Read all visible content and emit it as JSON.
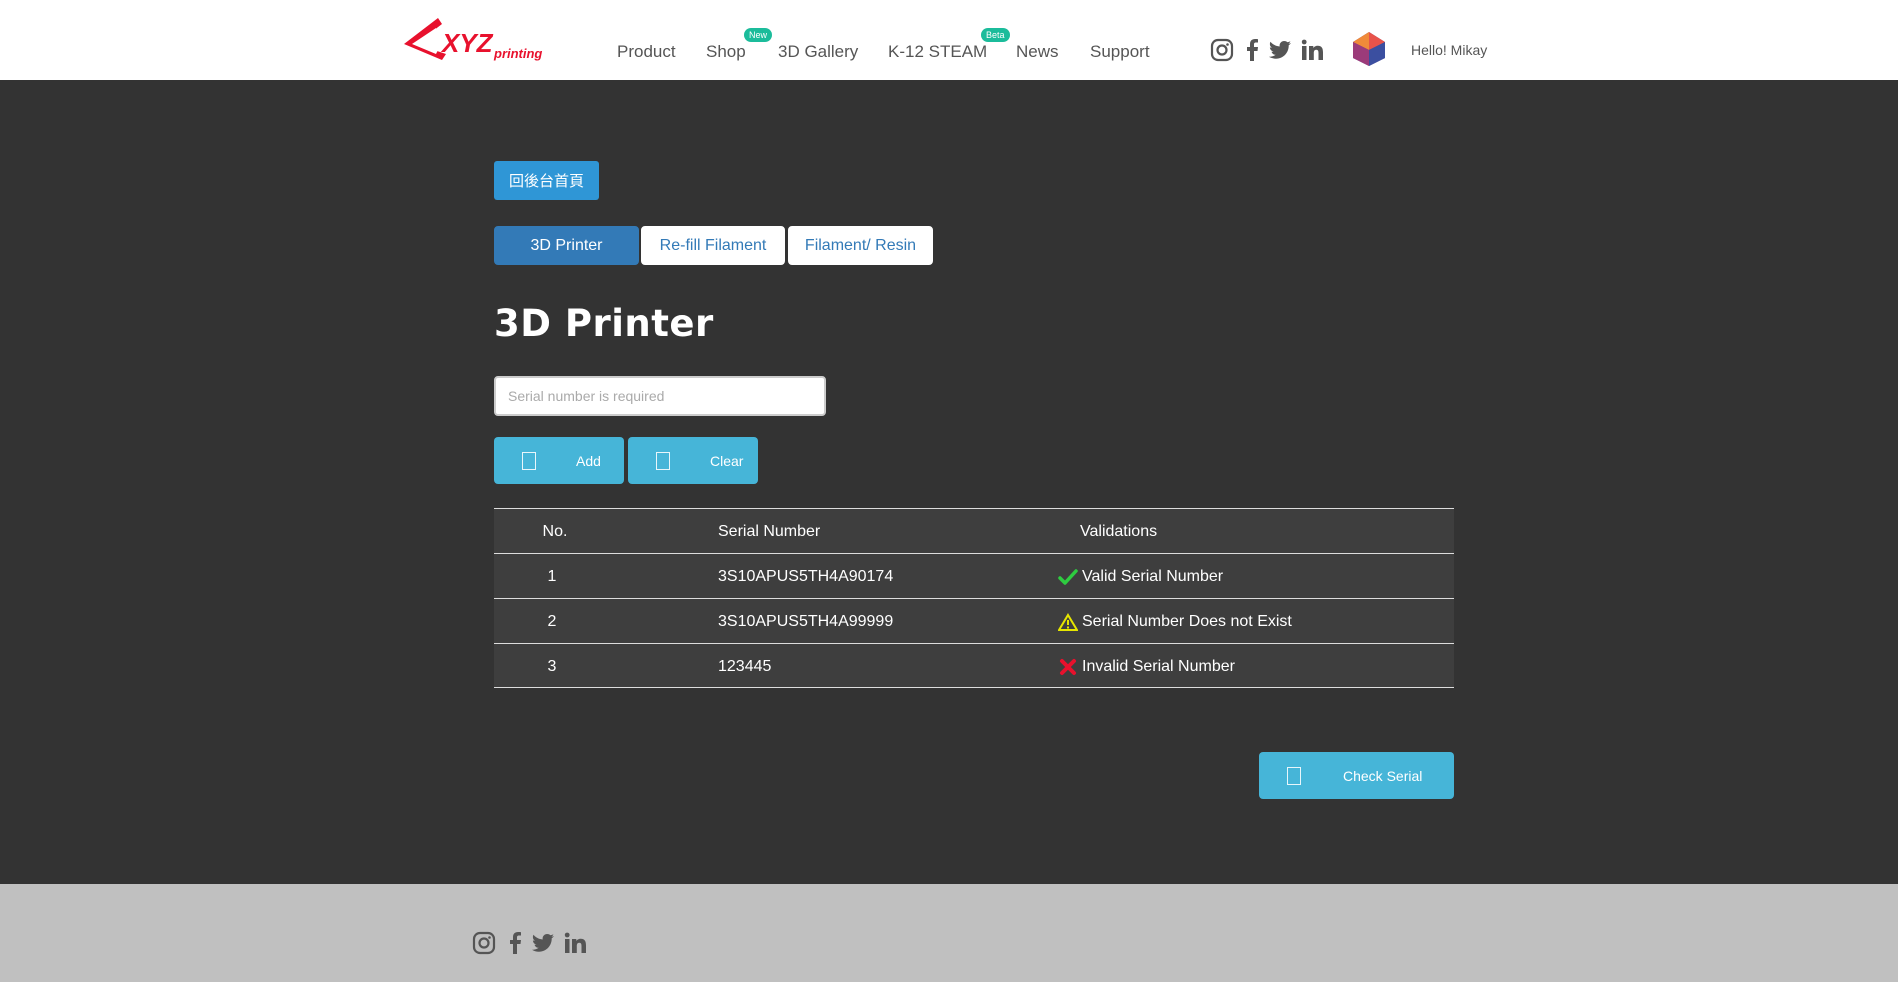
{
  "header": {
    "nav": [
      {
        "label": "Product"
      },
      {
        "label": "Shop",
        "badge": "New"
      },
      {
        "label": "3D Gallery"
      },
      {
        "label": "K-12 STEAM",
        "badge": "Beta"
      },
      {
        "label": "News"
      },
      {
        "label": "Support"
      }
    ],
    "social_icons": [
      "instagram-icon",
      "facebook-icon",
      "twitter-icon",
      "linkedin-icon"
    ],
    "greeting": "Hello! Mikay"
  },
  "main": {
    "back_button": "回後台首頁",
    "tabs": [
      {
        "label": "3D Printer",
        "active": true
      },
      {
        "label": "Re-fill Filament",
        "active": false
      },
      {
        "label": "Filament/ Resin",
        "active": false
      }
    ],
    "title": "3D Printer",
    "serial_input": {
      "placeholder": "Serial number is required",
      "value": ""
    },
    "add_button": "Add",
    "clear_button": "Clear",
    "table": {
      "headers": [
        "No.",
        "Serial Number",
        "Validations"
      ],
      "rows": [
        {
          "no": "1",
          "serial": "3S10APUS5TH4A90174",
          "validation": "Valid Serial Number",
          "status": "valid"
        },
        {
          "no": "2",
          "serial": "3S10APUS5TH4A99999",
          "validation": "Serial Number Does not Exist",
          "status": "warning"
        },
        {
          "no": "3",
          "serial": "123445",
          "validation": "Invalid Serial Number",
          "status": "invalid"
        }
      ]
    },
    "check_button": "Check Serial"
  },
  "colors": {
    "accent": "#46b5d8",
    "tab_active": "#337ab7",
    "valid": "#2ecc40",
    "warning": "#e6e600",
    "invalid": "#e8112d"
  }
}
